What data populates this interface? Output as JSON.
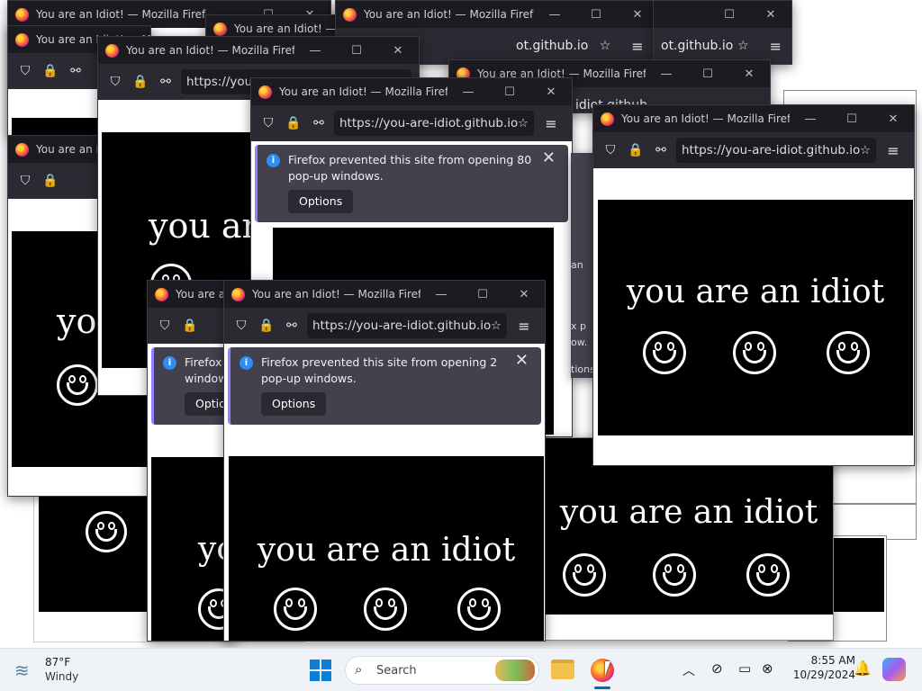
{
  "browser": {
    "window_title": "You are an Idiot! — Mozilla Firefox",
    "window_title_short": "You are an Idiot! — Mozilla Firefox",
    "url": "https://you-are-idiot.github.io",
    "url_fragment_1": "https://you-",
    "url_fragment_2": "ot.github.io",
    "url_fragment_3": "ub.io",
    "url_fragment_4": "idiot.github",
    "url_fragment_5": "https",
    "window_controls": {
      "minimize": "—",
      "maximize": "☐",
      "close": "✕"
    }
  },
  "notices": {
    "popup_80": "Firefox prevented this site from opening 80 pop-up windows.",
    "popup_2": "Firefox prevented this site from opening 2 pop-up windows.",
    "popup_partial": "Firefox p window.",
    "popup_partial_a": "Firefox p",
    "popup_partial_b": "window.",
    "options_button": "Options",
    "options_partial": "Option",
    "side_fragments": [
      "an",
      "x p",
      "ow.",
      "tions"
    ]
  },
  "page": {
    "phrase": "you are an idiot",
    "phrase_partial_1": "you are",
    "phrase_partial_2": "you",
    "phrase_partial_3": "yo"
  },
  "taskbar": {
    "weather_temp": "87°F",
    "weather_desc": "Windy",
    "search_placeholder": "Search",
    "time": "8:55 AM",
    "date": "10/29/2024"
  },
  "colors": {
    "titlebar": "#1c1b22",
    "navbar": "#2b2a33",
    "notice_bg": "#42414d",
    "info_blue": "#2f8cf0",
    "taskbar_bg": "#eff3f8"
  },
  "icons": [
    "firefox-icon",
    "shield-icon",
    "lock-icon",
    "permissions-icon",
    "star-icon",
    "hamburger-menu-icon",
    "info-icon",
    "close-icon",
    "windows-start-icon",
    "search-icon",
    "file-explorer-icon",
    "weather-icon",
    "chevron-up-icon",
    "network-icon",
    "notification-bell-icon",
    "copilot-icon"
  ]
}
